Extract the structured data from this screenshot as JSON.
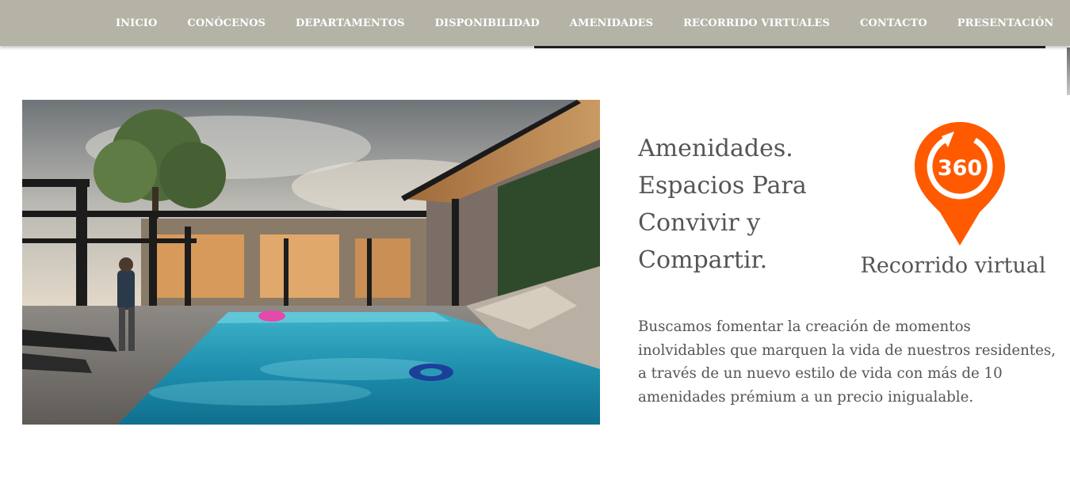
{
  "nav": {
    "items": [
      {
        "label": "INICIO"
      },
      {
        "label": "CONÓCENOS"
      },
      {
        "label": "DEPARTAMENTOS"
      },
      {
        "label": "DISPONIBILIDAD"
      },
      {
        "label": "AMENIDADES"
      },
      {
        "label": "RECORRIDO VIRTUALES"
      },
      {
        "label": "CONTACTO"
      },
      {
        "label": "PRESENTACIÓN"
      }
    ],
    "background_color": "#b4b3a6",
    "active_indicator_color": "#1e1e1e"
  },
  "hero_image": {
    "subject": "pool-amenity-render-icon"
  },
  "section": {
    "heading_lines": [
      "Amenidades.",
      "Espacios Para",
      "Convivir y",
      "Compartir."
    ],
    "description": "Buscamos fomentar la creación de momentos inolvidables que marquen la vida de nuestros residentes, a través de un nuevo estilo de vida con más de 10 amenidades prémium a un precio inigualable."
  },
  "virtual_tour": {
    "badge_text": "360",
    "label": "Recorrido virtual",
    "icon": "location-pin-360-icon",
    "accent_color": "#ff5a00"
  }
}
